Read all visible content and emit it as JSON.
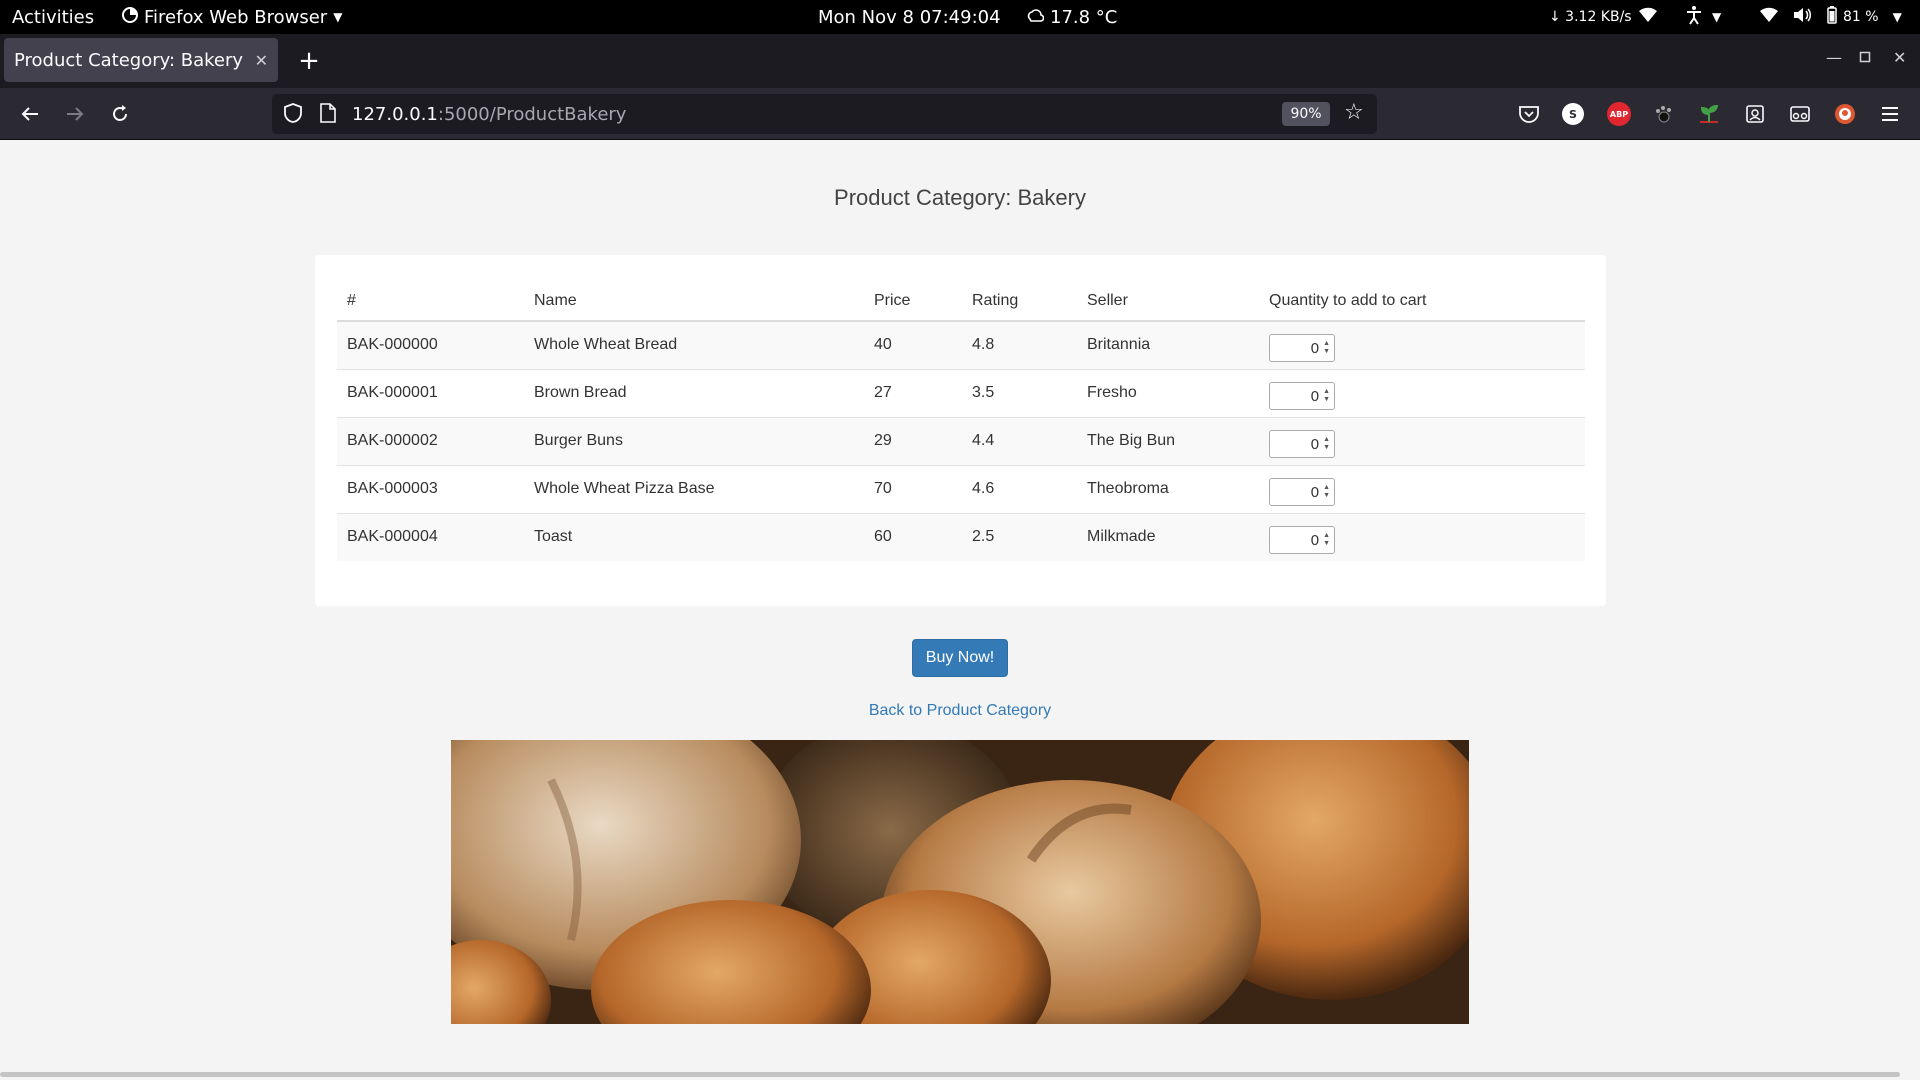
{
  "system_bar": {
    "activities": "Activities",
    "app_name": "Firefox Web Browser",
    "clock": "Mon Nov 8  07:49:04",
    "weather": "17.8 °C",
    "net_speed": "↓ 3.12 KB/s",
    "battery": "81 %"
  },
  "browser": {
    "tab_title": "Product Category: Bakery",
    "url_host": "127.0.0.1",
    "url_rest": ":5000/ProductBakery",
    "zoom": "90%",
    "extensions": [
      "pocket-icon",
      "s-icon",
      "adblock-plus-icon",
      "paw-icon",
      "plant-icon",
      "reader-icon",
      "glasses-icon",
      "duckduckgo-icon"
    ]
  },
  "page": {
    "title": "Product Category: Bakery",
    "table": {
      "headers": [
        "#",
        "Name",
        "Price",
        "Rating",
        "Seller",
        "Quantity to add to cart"
      ],
      "rows": [
        {
          "id": "BAK-000000",
          "name": "Whole Wheat Bread",
          "price": "40",
          "rating": "4.8",
          "seller": "Britannia",
          "qty": "0"
        },
        {
          "id": "BAK-000001",
          "name": "Brown Bread",
          "price": "27",
          "rating": "3.5",
          "seller": "Fresho",
          "qty": "0"
        },
        {
          "id": "BAK-000002",
          "name": "Burger Buns",
          "price": "29",
          "rating": "4.4",
          "seller": "The Big Bun",
          "qty": "0"
        },
        {
          "id": "BAK-000003",
          "name": "Whole Wheat Pizza Base",
          "price": "70",
          "rating": "4.6",
          "seller": "Theobroma",
          "qty": "0"
        },
        {
          "id": "BAK-000004",
          "name": "Toast",
          "price": "60",
          "rating": "2.5",
          "seller": "Milkmade",
          "qty": "0"
        }
      ]
    },
    "buy_label": "Buy Now!",
    "back_label": "Back to Product Category"
  },
  "colors": {
    "accent": "#337ab7",
    "browser_bg": "#2b2a33",
    "page_bg": "#f4f4f4"
  }
}
